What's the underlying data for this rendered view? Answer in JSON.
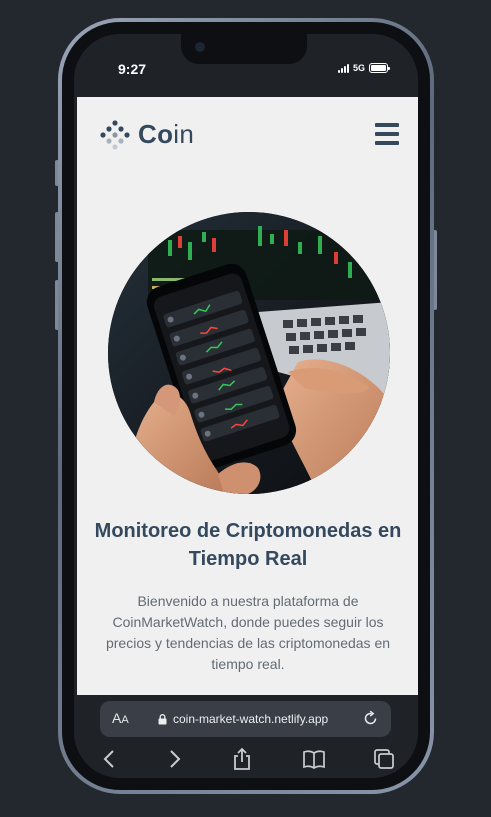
{
  "status_bar": {
    "time": "9:27",
    "network": "5G"
  },
  "site": {
    "logo_bold": "Co",
    "logo_rest": "in",
    "hero_title": "Monitoreo de Criptomonedas en Tiempo Real",
    "hero_description": "Bienvenido a nuestra plataforma de CoinMarketWatch, donde puedes seguir los precios y tendencias de las criptomonedas en tiempo real."
  },
  "browser": {
    "text_size_big": "A",
    "text_size_small": "A",
    "url": "coin-market-watch.netlify.app"
  },
  "colors": {
    "brand": "#34495e",
    "page_background": "#f0f0f0",
    "chrome_background": "#1f2227",
    "url_field": "#3a3f47"
  },
  "icons": {
    "logo": "coin-logo-icon",
    "menu": "hamburger-menu-icon",
    "lock": "lock-icon",
    "reload": "reload-icon",
    "back": "back-icon",
    "forward": "forward-icon",
    "share": "share-icon",
    "bookmarks": "bookmarks-icon",
    "tabs": "tabs-icon"
  }
}
